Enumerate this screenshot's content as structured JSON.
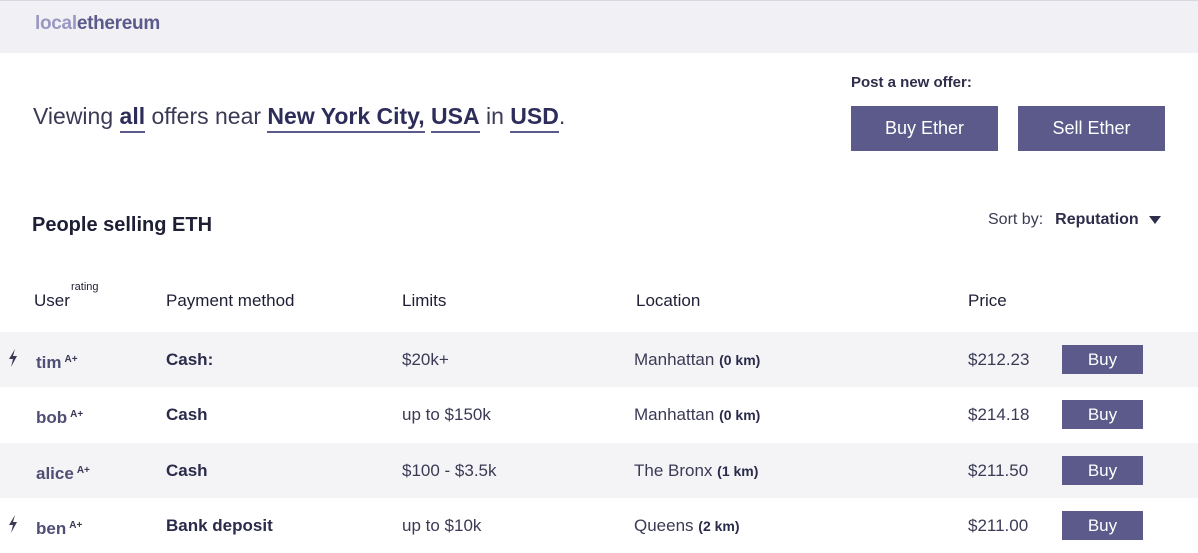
{
  "app": {
    "logo_part1": "local",
    "logo_part2": "ethereum"
  },
  "filter": {
    "prefix": "Viewing",
    "scope": "all",
    "middle": "offers near",
    "city": "New York City,",
    "country": "USA",
    "in_word": "in",
    "currency": "USD",
    "suffix": "."
  },
  "post_offer": {
    "label": "Post a new offer:",
    "buy_label": "Buy Ether",
    "sell_label": "Sell Ether"
  },
  "section": {
    "title": "People selling ETH",
    "sort_label": "Sort by:",
    "sort_value": "Reputation"
  },
  "table": {
    "headers": {
      "user": "User",
      "rating": "rating",
      "payment": "Payment method",
      "limits": "Limits",
      "location": "Location",
      "price": "Price"
    },
    "buy_label": "Buy",
    "rows": [
      {
        "user": "tim",
        "rating": "A+",
        "instant": true,
        "method": "Cash:",
        "limits": "$20k+",
        "location": "Manhattan",
        "distance": "(0 km)",
        "price": "$212.23"
      },
      {
        "user": "bob",
        "rating": "A+",
        "instant": false,
        "method": "Cash",
        "limits": "up to $150k",
        "location": "Manhattan",
        "distance": "(0 km)",
        "price": "$214.18"
      },
      {
        "user": "alice",
        "rating": "A+",
        "instant": false,
        "method": "Cash",
        "limits": "$100 - $3.5k",
        "location": "The Bronx",
        "distance": "(1 km)",
        "price": "$211.50"
      },
      {
        "user": "ben",
        "rating": "A+",
        "instant": true,
        "method": "Bank deposit",
        "limits": "up to $10k",
        "location": "Queens",
        "distance": "(2 km)",
        "price": "$211.00"
      }
    ]
  },
  "colors": {
    "accent": "#5b5a8a",
    "logo_light": "#9a97c2",
    "row_shade": "#f4f4f7",
    "topbar": "#f1f0f5"
  },
  "icons": {
    "instant": "lightning-bolt-icon",
    "sort": "caret-down-icon"
  }
}
